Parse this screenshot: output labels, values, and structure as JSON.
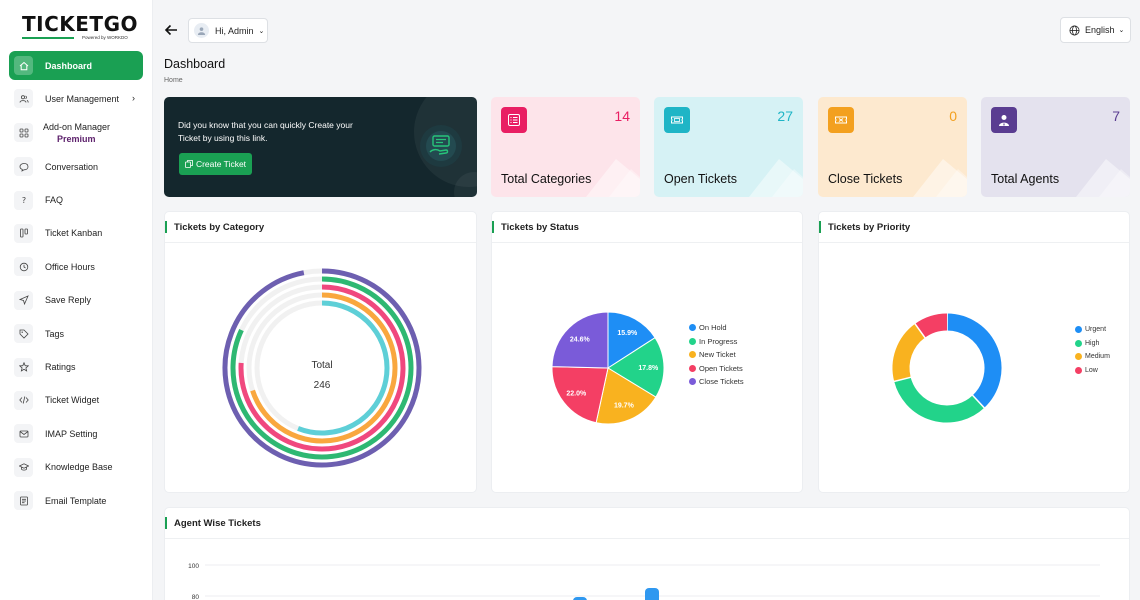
{
  "app": {
    "logo_name": "TICKETGO",
    "logo_tagline": "Powered by WORKDO"
  },
  "sidebar": {
    "items": [
      {
        "label": "Dashboard",
        "icon": "home-icon",
        "active": true
      },
      {
        "label": "User Management",
        "icon": "users-icon",
        "has_chevron": true
      },
      {
        "label": "Add-on Manager",
        "sublabel": "Premium",
        "icon": "addon-icon"
      },
      {
        "label": "Conversation",
        "icon": "chat-icon"
      },
      {
        "label": "FAQ",
        "icon": "question-icon"
      },
      {
        "label": "Ticket Kanban",
        "icon": "kanban-icon"
      },
      {
        "label": "Office Hours",
        "icon": "clock-icon"
      },
      {
        "label": "Save Reply",
        "icon": "send-icon"
      },
      {
        "label": "Tags",
        "icon": "tag-icon"
      },
      {
        "label": "Ratings",
        "icon": "star-icon"
      },
      {
        "label": "Ticket Widget",
        "icon": "code-icon"
      },
      {
        "label": "IMAP Setting",
        "icon": "mail-icon"
      },
      {
        "label": "Knowledge Base",
        "icon": "graduation-icon"
      },
      {
        "label": "Email Template",
        "icon": "template-icon"
      }
    ]
  },
  "header": {
    "user_label": "Hi, Admin",
    "language": "English"
  },
  "page": {
    "title": "Dashboard",
    "breadcrumb": "Home"
  },
  "promo": {
    "text": "Did you know that you can quickly Create your Ticket by using this link.",
    "button_label": "Create Ticket"
  },
  "stats": [
    {
      "label": "Total Categories",
      "value": "14",
      "color": "#e91e63",
      "bg": "#fde4ea",
      "icon": "list-icon"
    },
    {
      "label": "Open Tickets",
      "value": "27",
      "color": "#1fb5c6",
      "bg": "#d6f2f5",
      "icon": "ticket-icon"
    },
    {
      "label": "Close Tickets",
      "value": "0",
      "color": "#f3a01f",
      "bg": "#fde9cf",
      "icon": "closed-ticket-icon"
    },
    {
      "label": "Total Agents",
      "value": "7",
      "color": "#5a3d91",
      "bg": "#e4e2ee",
      "icon": "agent-icon"
    }
  ],
  "panels": {
    "category": {
      "title": "Tickets by Category",
      "center_label": "Total",
      "center_value": "246"
    },
    "status": {
      "title": "Tickets by Status"
    },
    "priority": {
      "title": "Tickets by Priority"
    },
    "agent": {
      "title": "Agent Wise Tickets"
    }
  },
  "chart_data": [
    {
      "type": "radialBar",
      "title": "Tickets by Category",
      "center_label": "Total",
      "center_value": 246,
      "series": [
        {
          "color": "#6d5fb0",
          "fraction": 0.97
        },
        {
          "color": "#2eb872",
          "fraction": 0.82
        },
        {
          "color": "#f0487e",
          "fraction": 0.76
        },
        {
          "color": "#f9a73e",
          "fraction": 0.7
        },
        {
          "color": "#5ecfd7",
          "fraction": 0.56
        }
      ]
    },
    {
      "type": "pie",
      "title": "Tickets by Status",
      "categories": [
        "On Hold",
        "In Progress",
        "New Ticket",
        "Open Tickets",
        "Close Tickets"
      ],
      "values": [
        15.9,
        17.8,
        19.7,
        22.0,
        24.6
      ],
      "labels": [
        "15.9%",
        "17.8%",
        "19.7%",
        "22.0%",
        "24.6%"
      ],
      "colors": [
        "#1e8ef5",
        "#22d38a",
        "#f9b21f",
        "#f43f64",
        "#7a5bd9"
      ],
      "legend_position": "right"
    },
    {
      "type": "donut",
      "title": "Tickets by Priority",
      "categories": [
        "Urgent",
        "High",
        "Medium",
        "Low"
      ],
      "values": [
        38,
        33,
        19,
        10
      ],
      "colors": [
        "#1e8ef5",
        "#22d38a",
        "#f9b21f",
        "#f43f64"
      ],
      "legend_position": "right"
    },
    {
      "type": "bar",
      "title": "Agent Wise Tickets",
      "yticks": [
        "100",
        "80"
      ],
      "ylim": [
        0,
        100
      ]
    }
  ]
}
